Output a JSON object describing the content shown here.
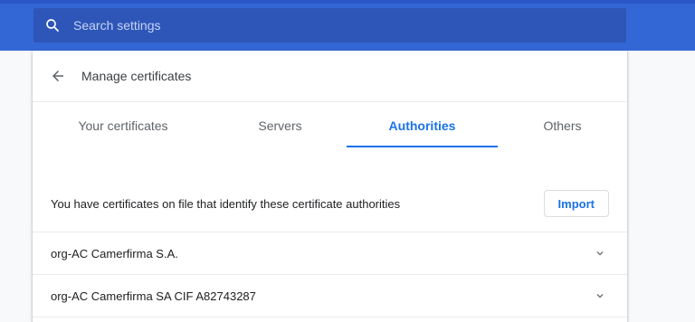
{
  "search": {
    "placeholder": "Search settings",
    "icon": "search-icon"
  },
  "header": {
    "title": "Manage certificates",
    "back_icon": "arrow-back-icon"
  },
  "tabs": [
    {
      "label": "Your certificates",
      "active": false
    },
    {
      "label": "Servers",
      "active": false
    },
    {
      "label": "Authorities",
      "active": true
    },
    {
      "label": "Others",
      "active": false
    }
  ],
  "authorities": {
    "intro_text": "You have certificates on file that identify these certificate authorities",
    "import_label": "Import",
    "items": [
      {
        "label": "org-AC Camerfirma S.A.",
        "icon": "chevron-down-icon"
      },
      {
        "label": "org-AC Camerfirma SA CIF A82743287",
        "icon": "chevron-down-icon"
      }
    ]
  },
  "colors": {
    "toolbar": "#3367d6",
    "search_bg": "#2e56b8",
    "accent": "#1a73e8",
    "page_bg": "#f8f9fa"
  }
}
